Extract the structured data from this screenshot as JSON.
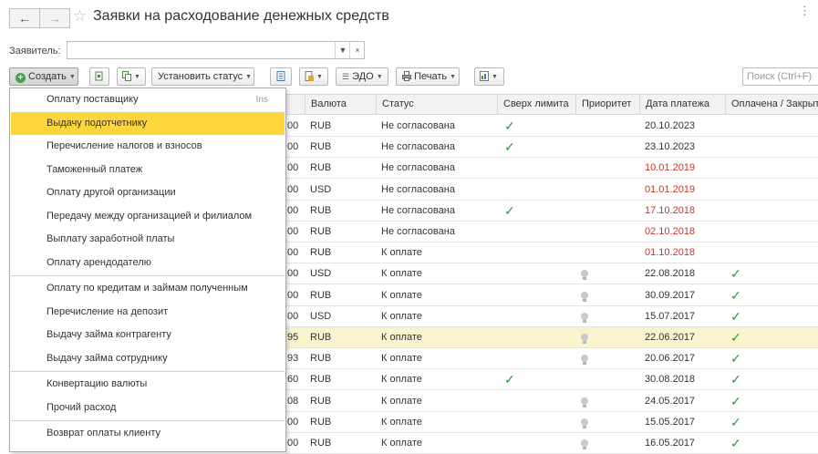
{
  "window": {
    "title": "Заявки на расходование денежных средств"
  },
  "filter": {
    "label": "Заявитель:",
    "value": ""
  },
  "toolbar": {
    "create": "Создать",
    "set_status": "Установить статус",
    "edo": "ЭДО",
    "print": "Печать",
    "search_placeholder": "Поиск (Ctrl+F)"
  },
  "menu": {
    "items": [
      {
        "label": "Оплату поставщику",
        "shortcut": "Ins"
      },
      {
        "label": "Выдачу подотчетнику"
      },
      {
        "label": "Перечисление налогов и взносов"
      },
      {
        "label": "Таможенный платеж"
      },
      {
        "label": "Оплату другой организации"
      },
      {
        "label": "Передачу между организацией и филиалом"
      },
      {
        "label": "Выплату заработной платы"
      },
      {
        "label": "Оплату арендодателю"
      },
      {
        "label": "Оплату по кредитам и займам полученным"
      },
      {
        "label": "Перечисление на депозит"
      },
      {
        "label": "Выдачу займа контрагенту"
      },
      {
        "label": "Выдачу займа сотруднику"
      },
      {
        "label": "Конвертацию валюты"
      },
      {
        "label": "Прочий расход"
      },
      {
        "label": "Возврат оплаты клиенту"
      }
    ],
    "selected_index": 1
  },
  "table": {
    "columns": [
      "Валюта",
      "Статус",
      "Сверх лимита",
      "Приоритет",
      "Дата платежа",
      "Оплачена / Закрыта"
    ],
    "rows": [
      {
        "amt": "00",
        "cur": "RUB",
        "status": "Не согласована",
        "over": "✓",
        "prio": false,
        "date": "20.10.2023",
        "overdue": false,
        "paid": ""
      },
      {
        "amt": "00",
        "cur": "RUB",
        "status": "Не согласована",
        "over": "✓",
        "prio": false,
        "date": "23.10.2023",
        "overdue": false,
        "paid": ""
      },
      {
        "amt": "00",
        "cur": "RUB",
        "status": "Не согласована",
        "over": "",
        "prio": false,
        "date": "10.01.2019",
        "overdue": true,
        "paid": ""
      },
      {
        "amt": "00",
        "cur": "USD",
        "status": "Не согласована",
        "over": "",
        "prio": false,
        "date": "01.01.2019",
        "overdue": true,
        "paid": ""
      },
      {
        "amt": "00",
        "cur": "RUB",
        "status": "Не согласована",
        "over": "✓",
        "prio": false,
        "date": "17.10.2018",
        "overdue": true,
        "paid": ""
      },
      {
        "amt": "00",
        "cur": "RUB",
        "status": "Не согласована",
        "over": "",
        "prio": false,
        "date": "02.10.2018",
        "overdue": true,
        "paid": ""
      },
      {
        "amt": "00",
        "cur": "RUB",
        "status": "К оплате",
        "over": "",
        "prio": false,
        "date": "01.10.2018",
        "overdue": true,
        "paid": ""
      },
      {
        "amt": "00",
        "cur": "USD",
        "status": "К оплате",
        "over": "",
        "prio": true,
        "date": "22.08.2018",
        "overdue": false,
        "paid": "✓"
      },
      {
        "amt": "00",
        "cur": "RUB",
        "status": "К оплате",
        "over": "",
        "prio": true,
        "date": "30.09.2017",
        "overdue": false,
        "paid": "✓"
      },
      {
        "amt": "00",
        "cur": "USD",
        "status": "К оплате",
        "over": "",
        "prio": true,
        "date": "15.07.2017",
        "overdue": false,
        "paid": "✓"
      },
      {
        "amt": "95",
        "cur": "RUB",
        "status": "К оплате",
        "over": "",
        "prio": true,
        "date": "22.06.2017",
        "overdue": false,
        "paid": "✓",
        "highlight": true
      },
      {
        "amt": "93",
        "cur": "RUB",
        "status": "К оплате",
        "over": "",
        "prio": true,
        "date": "20.06.2017",
        "overdue": false,
        "paid": "✓"
      },
      {
        "amt": "60",
        "cur": "RUB",
        "status": "К оплате",
        "over": "✓",
        "prio": false,
        "date": "30.08.2018",
        "overdue": false,
        "paid": "✓"
      },
      {
        "amt": "08",
        "cur": "RUB",
        "status": "К оплате",
        "over": "",
        "prio": true,
        "date": "24.05.2017",
        "overdue": false,
        "paid": "✓"
      },
      {
        "amt": "00",
        "cur": "RUB",
        "status": "К оплате",
        "over": "",
        "prio": true,
        "date": "15.05.2017",
        "overdue": false,
        "paid": "✓"
      },
      {
        "amt": "00",
        "cur": "RUB",
        "status": "К оплате",
        "over": "",
        "prio": true,
        "date": "16.05.2017",
        "overdue": false,
        "paid": "✓"
      }
    ]
  },
  "colors": {
    "selected_menu": "#fcd63b",
    "overdue_date": "#c0392b",
    "check": "#2c9a3e",
    "highlight_row": "#fbf3cd"
  }
}
